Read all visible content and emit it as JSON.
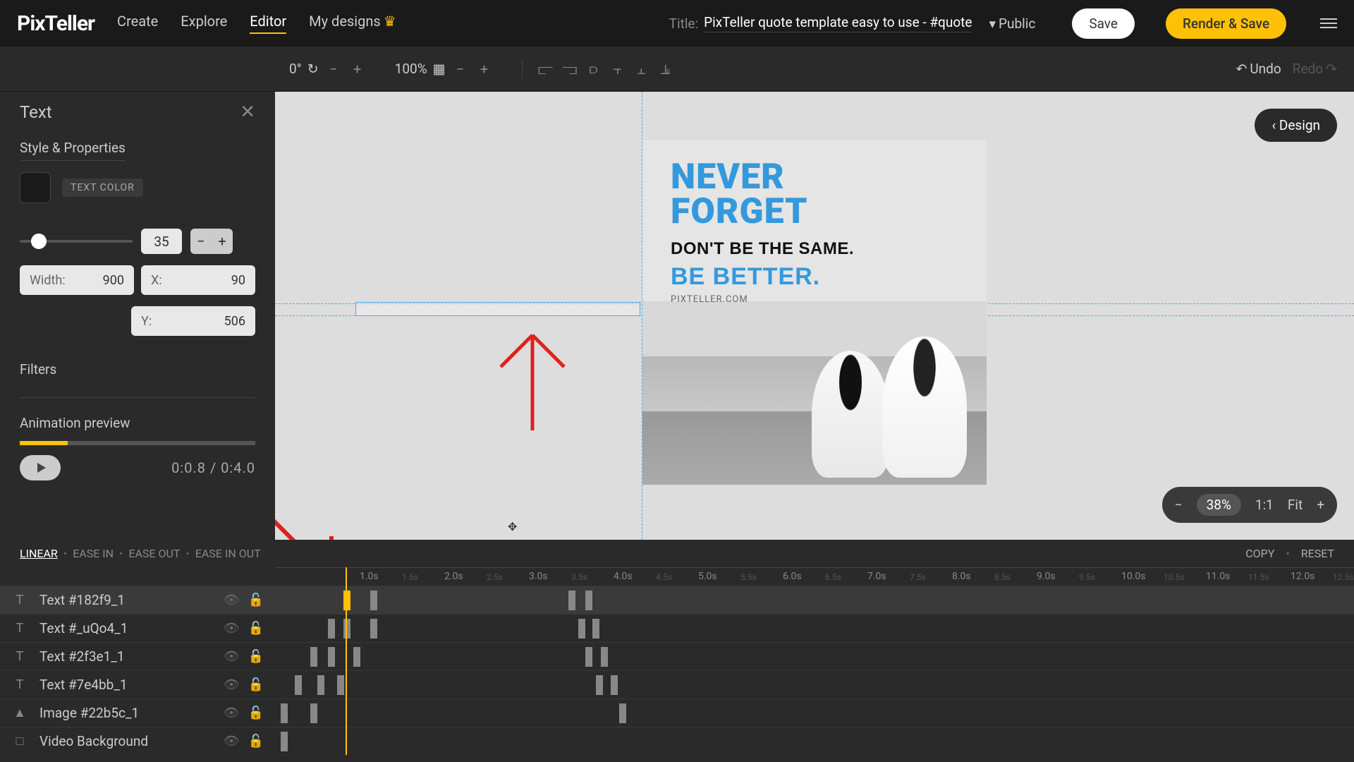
{
  "nav": {
    "logo": "PixTeller",
    "links": {
      "create": "Create",
      "explore": "Explore",
      "editor": "Editor",
      "mydesigns": "My designs"
    },
    "title_label": "Title:",
    "title": "PixTeller quote template easy to use - #quote",
    "visibility": "Public",
    "save": "Save",
    "render": "Render & Save"
  },
  "toolbar": {
    "rotate": "0°",
    "opacity": "100%",
    "undo": "Undo",
    "redo": "Redo"
  },
  "panel": {
    "title": "Text",
    "style": "Style & Properties",
    "text_color": "TEXT COLOR",
    "size": "35",
    "width_label": "Width:",
    "width": "900",
    "x_label": "X:",
    "x": "90",
    "y_label": "Y:",
    "y": "506",
    "filters": "Filters",
    "anim": "Animation preview",
    "time": "0:0.8 / 0:4.0"
  },
  "canvas": {
    "design_btn": "Design",
    "t1a": "NEVER",
    "t1b": "FORGET",
    "t2": "DON'T BE THE SAME.",
    "t3": "BE BETTER.",
    "url": "PIXTELLER.COM",
    "zoom_minus": "−",
    "zoom_pct": "38%",
    "ratio": "1:1",
    "fit": "Fit",
    "zoom_plus": "+"
  },
  "ease": {
    "linear": "LINEAR",
    "in": "EASE IN",
    "out": "EASE OUT",
    "inout": "EASE IN OUT",
    "copy": "COPY",
    "reset": "RESET"
  },
  "ticks": [
    "1.0s",
    "1.5s",
    "2.0s",
    "2.5s",
    "3.0s",
    "3.5s",
    "4.0s",
    "4.5s",
    "5.0s",
    "5.5s",
    "6.0s",
    "6.5s",
    "7.0s",
    "7.5s",
    "8.0s",
    "8.5s",
    "9.0s",
    "9.5s",
    "10.0s",
    "10.5s",
    "11.0s",
    "11.5s",
    "12.0s",
    "12.5s"
  ],
  "layers": [
    {
      "name": "Text #182f9_1",
      "icon": "T"
    },
    {
      "name": "Text #_uQo4_1",
      "icon": "T"
    },
    {
      "name": "Text #2f3e1_1",
      "icon": "T"
    },
    {
      "name": "Text #7e4bb_1",
      "icon": "T"
    },
    {
      "name": "Image #22b5c_1",
      "icon": "▲"
    },
    {
      "name": "Video Background",
      "icon": "□"
    }
  ]
}
